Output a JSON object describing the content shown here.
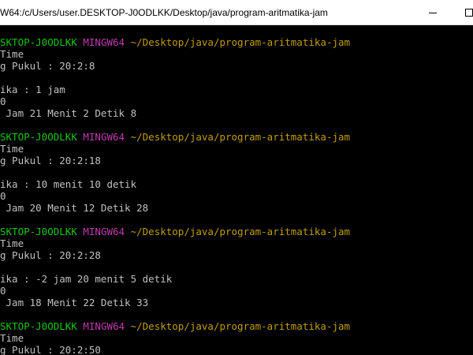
{
  "window": {
    "title": "W64:/c/Users/user.DESKTOP-J0ODLKK/Desktop/java/program-aritmatika-jam"
  },
  "terminal": {
    "colors": {
      "background": "#000000",
      "text": "#c0c0c0",
      "host": "#13c60f",
      "env": "#c239b3",
      "path": "#c19c00"
    },
    "prompt_host": "SKTOP-J0ODLKK",
    "prompt_env": "MINGW64",
    "prompt_path": "~/Desktop/java/program-aritmatika-jam",
    "lines": {
      "l1": "Time",
      "l2": "g Pukul : 20:2:8",
      "l3": "ika : 1 jam",
      "l4": "0",
      "l5": " Jam 21 Menit 2 Detik 8",
      "l6": "Time",
      "l7": "g Pukul : 20:2:18",
      "l8": "ika : 10 menit 10 detik",
      "l9": "0",
      "l10": " Jam 20 Menit 12 Detik 28",
      "l11": "Time",
      "l12": "g Pukul : 20:2:28",
      "l13": "ika : -2 jam 20 menit 5 detik",
      "l14": "0",
      "l15": " Jam 18 Menit 22 Detik 33",
      "l16": "Time",
      "l17": "g Pukul : 20:2:50"
    }
  }
}
